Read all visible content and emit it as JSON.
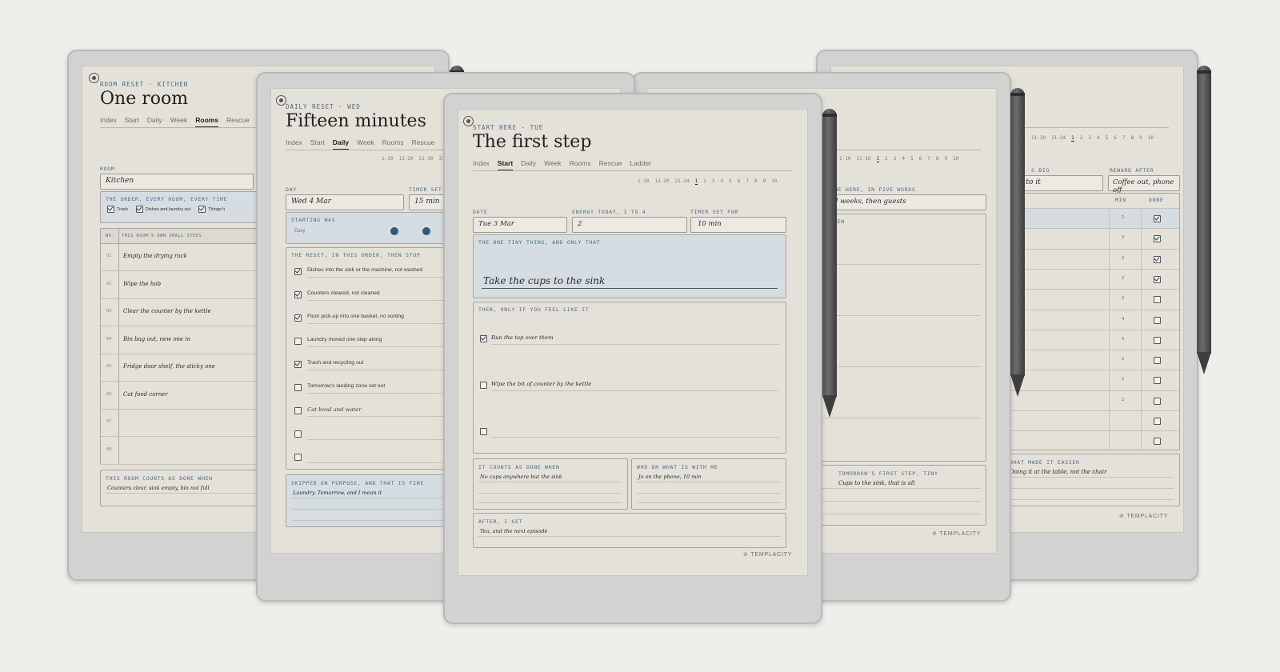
{
  "colors": {
    "background": "#efeeea",
    "accent": "#4a6a82",
    "highlight": "#d6dde2",
    "dot": "#2e5a76"
  },
  "room": {
    "kicker": "ROOM RESET · KITCHEN",
    "title": "One room",
    "nav": [
      "Index",
      "Start",
      "Daily",
      "Week",
      "Rooms",
      "Rescue"
    ],
    "nav_active": 4,
    "room_label": "ROOM",
    "room_value": "Kitchen",
    "order_label": "THE ORDER, EVERY ROOM, EVERY TIME",
    "order_items": [
      {
        "text": "Trash",
        "checked": true
      },
      {
        "text": "Dishes and laundry out",
        "checked": true
      },
      {
        "text": "Things h",
        "checked": true
      }
    ],
    "col_no": "NO.",
    "col_steps": "THIS ROOM'S OWN SMALL STEPS",
    "rows": [
      {
        "no": "01",
        "text": "Empty the drying rack"
      },
      {
        "no": "02",
        "text": "Wipe the hob"
      },
      {
        "no": "03",
        "text": "Clear the counter by the kettle"
      },
      {
        "no": "04",
        "text": "Bin bag out, new one in"
      },
      {
        "no": "05",
        "text": "Fridge door shelf, the sticky one"
      },
      {
        "no": "06",
        "text": "Cat food corner"
      },
      {
        "no": "07",
        "text": ""
      },
      {
        "no": "08",
        "text": ""
      }
    ],
    "done_label": "THIS ROOM COUNTS AS DONE WHEN",
    "done_value": "Counters clear, sink empty, bin not full"
  },
  "daily": {
    "kicker": "DAILY RESET · WED",
    "title": "Fifteen minutes",
    "nav": [
      "Index",
      "Start",
      "Daily",
      "Week",
      "Rooms",
      "Rescue"
    ],
    "nav_active": 2,
    "pager": [
      "1-10",
      "11-20",
      "21-30",
      "31-"
    ],
    "day_label": "DAY",
    "day_value": "Wed 4 Mar",
    "timer_label": "TIMER SET",
    "timer_value": "15 min",
    "starting_label": "STARTING WAS",
    "starting_value": "Easy",
    "reset_label": "THE RESET, IN THIS ORDER, THEN STOP",
    "tasks": [
      {
        "text": "Dishes into the sink or the machine, not washed",
        "checked": true
      },
      {
        "text": "Counters cleared, not cleaned",
        "checked": true
      },
      {
        "text": "Floor pick-up into one basket, no sorting",
        "checked": true
      },
      {
        "text": "Laundry moved one step along",
        "checked": false
      },
      {
        "text": "Trash and recycling out",
        "checked": true
      },
      {
        "text": "Tomorrow's landing zone set out",
        "checked": false
      },
      {
        "text": "Cat bowl and water",
        "checked": false
      },
      {
        "text": "",
        "checked": false
      },
      {
        "text": "",
        "checked": false
      }
    ],
    "skipped_label": "SKIPPED ON PURPOSE, AND THAT IS FINE",
    "skipped_value": "Laundry. Tomorrow, and I mean it"
  },
  "start": {
    "kicker": "START HERE · TUE",
    "title": "The first step",
    "nav": [
      "Index",
      "Start",
      "Daily",
      "Week",
      "Rooms",
      "Rescue",
      "Ladder"
    ],
    "nav_active": 1,
    "pager": [
      "1-10",
      "11-20",
      "21-24",
      "1",
      "2",
      "3",
      "4",
      "5",
      "6",
      "7",
      "8",
      "9",
      "10"
    ],
    "pager_current": 3,
    "date_label": "DATE",
    "date_value": "Tue 3 Mar",
    "energy_label": "ENERGY TODAY, 1 TO 4",
    "energy_value": "2",
    "timer_label": "TIMER SET FOR",
    "timer_value": "10 min",
    "tiny_label": "THE ONE TINY THING, AND ONLY THAT",
    "tiny_value": "Take the cups to the sink",
    "then_label": "THEN, ONLY IF YOU FEEL LIKE IT",
    "then_items": [
      {
        "text": "Run the tap over them",
        "checked": true
      },
      {
        "text": "Wipe the bit of counter by the kettle",
        "checked": false
      },
      {
        "text": "",
        "checked": false
      }
    ],
    "counts_label": "IT COUNTS AS DONE WHEN",
    "counts_value": "No cups anywhere but the sink",
    "who_label": "WHO OR WHAT IS WITH ME",
    "who_value": "Jo on the phone, 10 min",
    "after_label": "AFTER, I GET",
    "after_value": "Tea, and the next episode",
    "logo": "TEMPLACITY"
  },
  "week": {
    "pager": [
      "1-10",
      "11-16",
      "1",
      "2",
      "3",
      "4",
      "5",
      "6",
      "7",
      "8",
      "9",
      "10"
    ],
    "pager_current": 2,
    "words_label": "ME HERE, IN FIVE WORDS",
    "words_value": "d weeks, then guests",
    "section_label": "EEN",
    "tomorrow_label": "TOMORROW'S FIRST STEP, TINY",
    "tomorrow_value": "Cups to the sink, that is all",
    "logo": "TEMPLACITY"
  },
  "ladder": {
    "pager": [
      "11-20",
      "21-24",
      "1",
      "2",
      "3",
      "4",
      "5",
      "6",
      "7",
      "8",
      "9",
      "10"
    ],
    "pager_current": 2,
    "big_label": "S BIG",
    "big_value": "nd to it",
    "reward_label": "REWARD AFTER",
    "reward_value": "Coffee out, phone off",
    "col_min": "MIN",
    "col_done": "DONE",
    "rows": [
      {
        "min": "1",
        "done": true
      },
      {
        "min": "3",
        "done": true
      },
      {
        "min": "2",
        "done": true
      },
      {
        "min": "2",
        "done": true
      },
      {
        "min": "2",
        "done": false
      },
      {
        "min": "4",
        "done": false
      },
      {
        "min": "5",
        "done": false
      },
      {
        "min": "1",
        "done": false
      },
      {
        "min": "1",
        "done": false
      },
      {
        "min": "2",
        "done": false
      },
      {
        "min": "",
        "done": false
      },
      {
        "min": "",
        "done": false
      }
    ],
    "easier_label": "WHAT MADE IT EASIER",
    "easier_value": "Doing it at the table, not the chair",
    "logo": "TEMPLACITY"
  }
}
